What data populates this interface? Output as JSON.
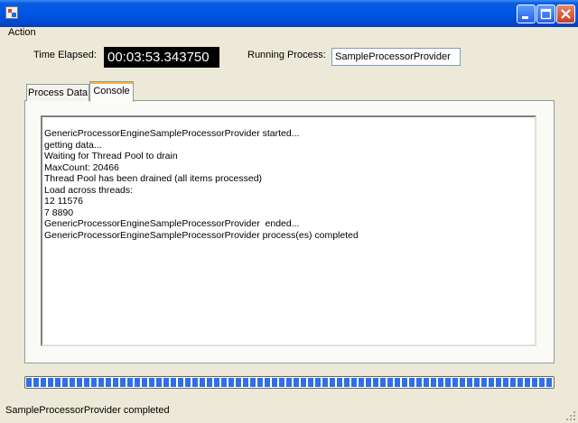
{
  "titlebar": {
    "app_icon": "application-icon",
    "minimize_icon": "minimize-icon",
    "maximize_icon": "maximize-icon",
    "close_icon": "close-icon",
    "close_color": "#c6401f",
    "accent": "#0055e5"
  },
  "menu": {
    "items": [
      {
        "label": "Action"
      }
    ]
  },
  "header": {
    "time_label": "Time Elapsed:",
    "time_value": "00:03:53.343750",
    "process_label": "Running Process:",
    "process_value": "SampleProcessorProvider"
  },
  "tabs": [
    {
      "label": "Process Data",
      "active": false
    },
    {
      "label": "Console",
      "active": true
    }
  ],
  "console": {
    "lines": [
      "GenericProcessorEngineSampleProcessorProvider started...",
      "getting data...",
      "Waiting for Thread Pool to drain",
      "MaxCount: 20466",
      "Thread Pool has been drained (all items processed)",
      "Load across threads:",
      "12 11576",
      "7 8890",
      "GenericProcessorEngineSampleProcessorProvider  ended...",
      "GenericProcessorEngineSampleProcessorProvider process(es) completed"
    ]
  },
  "progress": {
    "value_percent": 100,
    "color": "#2f6fe8"
  },
  "status": {
    "text": "SampleProcessorProvider completed",
    "grip_icon": "resize-grip-icon"
  }
}
